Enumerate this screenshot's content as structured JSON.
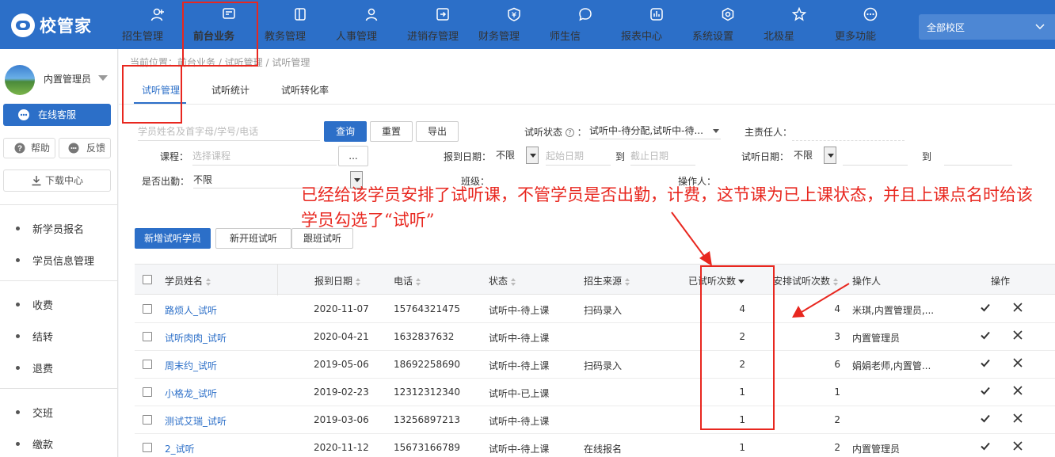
{
  "app": {
    "name": "校管家"
  },
  "nav": [
    {
      "label": "招生管理",
      "icon": "person-add-icon"
    },
    {
      "label": "前台业务",
      "icon": "monitor-icon"
    },
    {
      "label": "教务管理",
      "icon": "book-icon"
    },
    {
      "label": "人事管理",
      "icon": "user-icon"
    },
    {
      "label": "进销存管理",
      "icon": "inventory-icon"
    },
    {
      "label": "财务管理",
      "icon": "finance-icon"
    },
    {
      "label": "师生信",
      "icon": "chat-icon"
    },
    {
      "label": "报表中心",
      "icon": "report-icon"
    },
    {
      "label": "系统设置",
      "icon": "settings-icon"
    },
    {
      "label": "北极星",
      "icon": "star-icon"
    },
    {
      "label": "更多功能",
      "icon": "more-icon"
    }
  ],
  "active_nav": "前台业务",
  "campus": {
    "label": "全部校区"
  },
  "sidebar": {
    "user": "内置管理员",
    "service_btn": "在线客服",
    "help_btn": "帮助",
    "feedback_btn": "反馈",
    "download_btn": "下载中心",
    "groups": [
      [
        "新学员报名",
        "学员信息管理"
      ],
      [
        "收费",
        "结转",
        "退费"
      ],
      [
        "交班",
        "缴款"
      ]
    ]
  },
  "breadcrumb": "当前位置：前台业务 / 试听管理 / 试听管理",
  "tabs": [
    "试听管理",
    "试听统计",
    "试听转化率"
  ],
  "filters": {
    "search_placeholder": "学员姓名及首字母/学号/电话",
    "query_btn": "查询",
    "reset_btn": "重置",
    "export_btn": "导出",
    "trial_status_label": "试听状态",
    "trial_status_value": "试听中-待分配,试听中-待...",
    "owner_label": "主责任人：",
    "course_label": "课程：",
    "course_placeholder": "选择课程",
    "course_more": "...",
    "enroll_date_label": "报到日期：",
    "enroll_date_value": "不限",
    "start_date_placeholder": "起始日期",
    "to": "到",
    "end_date_placeholder": "截止日期",
    "trial_date_label": "试听日期：",
    "trial_date_value": "不限",
    "attend_label": "是否出勤：",
    "attend_value": "不限",
    "class_label": "班级：",
    "operator_label": "操作人："
  },
  "annotation": "已经给该学员安排了试听课，不管学员是否出勤，计费，这节课为已上课状态，并且上课点名时给该学员勾选了“试听”",
  "actions": {
    "add_trial": "新增试听学员",
    "new_class_trial": "新开班试听",
    "follow_class_trial": "跟班试听"
  },
  "table": {
    "columns": {
      "name": "学员姓名",
      "enroll_date": "报到日期",
      "phone": "电话",
      "status": "状态",
      "source": "招生来源",
      "trial_count": "已试听次数",
      "scheduled_count": "安排试听次数",
      "operator": "操作人",
      "ops": "操作"
    },
    "rows": [
      {
        "name": "路烦人_试听",
        "enroll_date": "2020-11-07",
        "phone": "15764321475",
        "status": "试听中-待上课",
        "source": "扫码录入",
        "trial_count": "4",
        "scheduled_count": "4",
        "operator": "米琪,内置管理员,..."
      },
      {
        "name": "试听肉肉_试听",
        "enroll_date": "2020-04-21",
        "phone": "1632837632",
        "status": "试听中-待上课",
        "source": "",
        "trial_count": "2",
        "scheduled_count": "3",
        "operator": "内置管理员"
      },
      {
        "name": "周末约_试听",
        "enroll_date": "2019-05-06",
        "phone": "18692258690",
        "status": "试听中-待上课",
        "source": "扫码录入",
        "trial_count": "2",
        "scheduled_count": "6",
        "operator": "娟娟老师,内置管..."
      },
      {
        "name": "小格龙_试听",
        "enroll_date": "2019-02-23",
        "phone": "12312312340",
        "status": "试听中-已上课",
        "source": "",
        "trial_count": "1",
        "scheduled_count": "1",
        "operator": ""
      },
      {
        "name": "测试艾瑞_试听",
        "enroll_date": "2019-03-06",
        "phone": "13256897213",
        "status": "试听中-待上课",
        "source": "",
        "trial_count": "1",
        "scheduled_count": "2",
        "operator": ""
      },
      {
        "name": "2_试听",
        "enroll_date": "2020-11-12",
        "phone": "15673166789",
        "status": "试听中-待上课",
        "source": "在线报名",
        "trial_count": "1",
        "scheduled_count": "2",
        "operator": "内置管理员"
      }
    ]
  },
  "colors": {
    "primary": "#2c6fc8",
    "annotation": "#e8271f"
  }
}
